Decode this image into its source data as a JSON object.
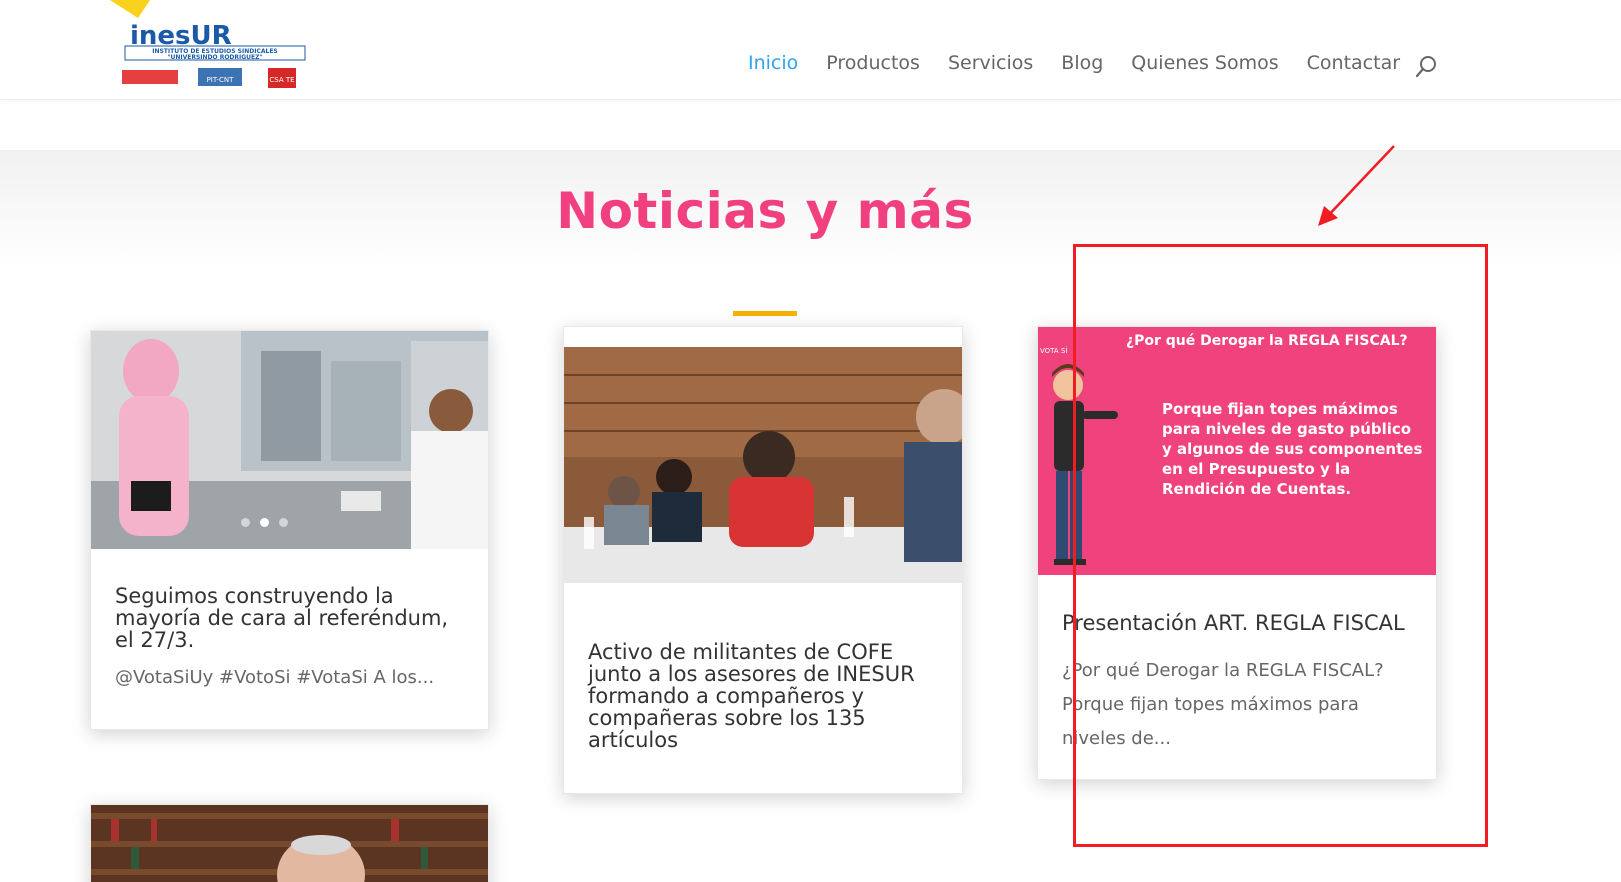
{
  "logo": {
    "brand": "inesUR",
    "line1": "INSTITUTO DE ESTUDIOS SINDICALES",
    "line2": "\"UNIVERSINDO RODRIGUEZ\"",
    "partner1": "PIT-CNT",
    "partner2": "CSA TE"
  },
  "nav": {
    "items": [
      "Inicio",
      "Productos",
      "Servicios",
      "Blog",
      "Quienes Somos",
      "Contactar"
    ],
    "active_index": 0,
    "search_icon": "search-icon"
  },
  "section": {
    "title": "Noticias y más"
  },
  "cards": [
    {
      "title": "Seguimos construyendo la mayoría de cara al referéndum, el 27/3.",
      "excerpt": "@VotaSiUy #VotoSi #VotaSi A los..."
    },
    {
      "title": "Activo de militantes de COFE junto a los asesores de INESUR formando a compañeros y compañeras sobre los 135 artículos",
      "excerpt": ""
    },
    {
      "title": "Presentación ART. REGLA FISCAL",
      "excerpt": "¿Por qué Derogar la REGLA FISCAL? Porque fijan topes máximos para niveles de...",
      "slide_question": "¿Por qué Derogar la REGLA FISCAL?",
      "slide_body": "Porque fijan topes máximos para niveles de gasto público y algunos de sus componentes en el Presupuesto y la Rendición de Cuentas.",
      "slide_tag": "VOTA SÍ"
    }
  ],
  "colors": {
    "accent_pink": "#f0407f",
    "nav_active": "#2ea3f2",
    "title_bar": "#f4b400",
    "annotation_red": "#f01d22"
  }
}
